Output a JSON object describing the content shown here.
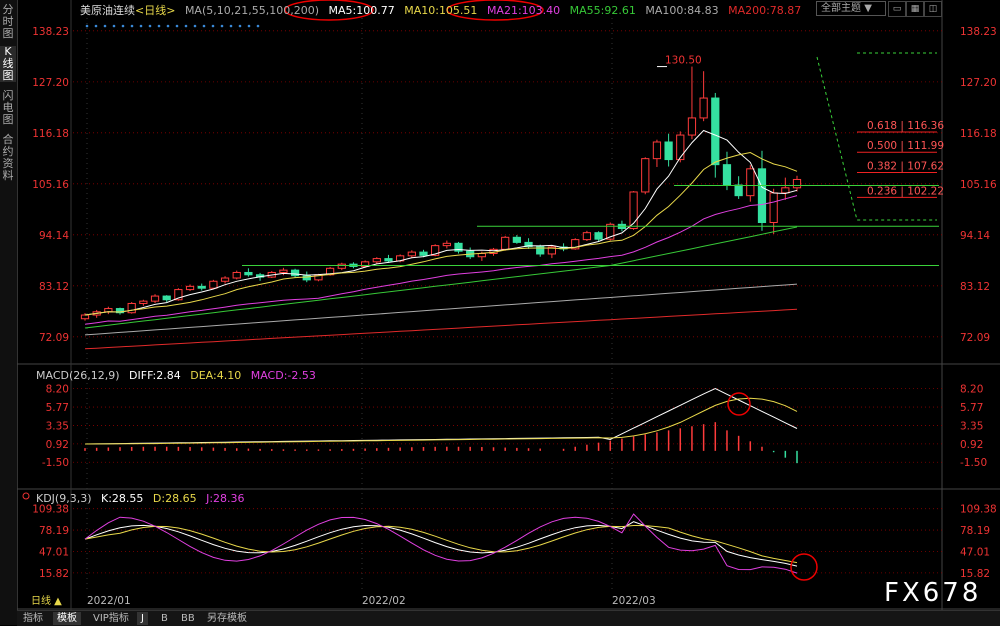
{
  "sidebar": {
    "tabs": [
      "分时图",
      "K线图",
      "闪电图",
      "合约资料"
    ]
  },
  "header": {
    "title": "美原油连续",
    "period": "<日线>",
    "ma_label": "MA(5,10,21,55,100,200)",
    "ma5": "MA5:100.77",
    "ma10": "MA10:105.51",
    "ma21": "MA21:103.40",
    "ma55": "MA55:92.61",
    "ma100": "MA100:84.83",
    "ma200": "MA200:78.87",
    "theme": "全部主题",
    "theme_arrow": "▼"
  },
  "colors": {
    "up": "#ff3b3b",
    "down": "#35e0a0",
    "ma5": "#ffffff",
    "ma10": "#e8d84a",
    "ma21": "#e040e0",
    "ma55": "#37c837",
    "ma100": "#aaaaaa",
    "ma200": "#e02a2a",
    "grid": "#8b0000",
    "level": "#3ad23a"
  },
  "chart_data": [
    {
      "type": "candlestick",
      "title": "美原油连续",
      "y_ticks": [
        "138.23",
        "127.20",
        "116.18",
        "105.16",
        "94.14",
        "83.12",
        "72.09"
      ],
      "ylim": [
        66,
        141
      ],
      "x_ticks": [
        "2022/01",
        "2022/02",
        "2022/03"
      ],
      "peak_label": "130.50",
      "fib_levels": [
        "0.618 | 116.36",
        "0.500 | 111.99",
        "0.382 | 107.62",
        "0.236 | 102.22"
      ],
      "candles": [
        [
          76.0,
          77.2,
          75.6,
          76.8
        ],
        [
          76.8,
          77.9,
          76.2,
          77.5
        ],
        [
          77.5,
          78.6,
          77.0,
          78.2
        ],
        [
          78.2,
          78.4,
          76.9,
          77.3
        ],
        [
          77.3,
          79.6,
          77.1,
          79.3
        ],
        [
          79.3,
          80.1,
          78.8,
          79.8
        ],
        [
          79.8,
          81.3,
          79.4,
          80.9
        ],
        [
          80.9,
          81.1,
          79.6,
          80.1
        ],
        [
          80.1,
          82.6,
          79.9,
          82.3
        ],
        [
          82.3,
          83.4,
          82.0,
          83.0
        ],
        [
          83.0,
          83.6,
          82.1,
          82.6
        ],
        [
          82.6,
          84.4,
          82.4,
          84.1
        ],
        [
          84.1,
          85.2,
          83.6,
          84.8
        ],
        [
          84.8,
          86.4,
          84.5,
          86.0
        ],
        [
          86.0,
          86.9,
          85.1,
          85.5
        ],
        [
          85.5,
          85.9,
          84.2,
          85.0
        ],
        [
          85.0,
          86.3,
          84.8,
          86.0
        ],
        [
          86.0,
          87.0,
          85.4,
          86.5
        ],
        [
          86.5,
          86.8,
          84.9,
          85.3
        ],
        [
          85.3,
          86.2,
          83.9,
          84.4
        ],
        [
          84.4,
          85.7,
          84.1,
          85.5
        ],
        [
          85.5,
          87.2,
          85.3,
          86.9
        ],
        [
          86.9,
          88.1,
          86.5,
          87.8
        ],
        [
          87.8,
          88.2,
          86.9,
          87.3
        ],
        [
          87.3,
          88.6,
          87.0,
          88.3
        ],
        [
          88.3,
          89.3,
          87.9,
          89.0
        ],
        [
          89.0,
          89.8,
          88.1,
          88.5
        ],
        [
          88.5,
          89.9,
          88.2,
          89.6
        ],
        [
          89.6,
          90.8,
          89.2,
          90.4
        ],
        [
          90.4,
          90.9,
          89.3,
          89.7
        ],
        [
          89.7,
          92.1,
          89.5,
          91.8
        ],
        [
          91.8,
          92.9,
          91.2,
          92.3
        ],
        [
          92.3,
          92.6,
          90.1,
          90.6
        ],
        [
          90.6,
          91.4,
          88.9,
          89.4
        ],
        [
          89.4,
          90.5,
          88.5,
          90.1
        ],
        [
          90.1,
          91.3,
          89.6,
          91.0
        ],
        [
          91.0,
          93.9,
          90.7,
          93.6
        ],
        [
          93.6,
          94.1,
          92.2,
          92.5
        ],
        [
          92.5,
          93.4,
          91.1,
          91.6
        ],
        [
          91.6,
          92.0,
          89.4,
          90.0
        ],
        [
          90.0,
          91.9,
          89.1,
          91.5
        ],
        [
          91.5,
          92.3,
          90.6,
          91.1
        ],
        [
          91.1,
          93.4,
          90.9,
          93.1
        ],
        [
          93.1,
          95.0,
          92.8,
          94.6
        ],
        [
          94.6,
          94.9,
          92.7,
          93.2
        ],
        [
          93.2,
          96.8,
          92.9,
          96.4
        ],
        [
          96.4,
          97.2,
          94.9,
          95.5
        ],
        [
          95.5,
          103.6,
          95.2,
          103.4
        ],
        [
          103.4,
          110.9,
          102.9,
          110.6
        ],
        [
          110.6,
          114.7,
          108.8,
          114.2
        ],
        [
          114.2,
          116.0,
          108.9,
          110.4
        ],
        [
          110.4,
          116.5,
          109.8,
          115.7
        ],
        [
          115.7,
          130.5,
          114.8,
          119.4
        ],
        [
          119.4,
          129.5,
          118.7,
          123.7
        ],
        [
          123.7,
          124.8,
          106.5,
          109.3
        ],
        [
          109.3,
          112.1,
          103.8,
          104.9
        ],
        [
          104.9,
          106.8,
          101.9,
          102.6
        ],
        [
          102.6,
          109.2,
          101.3,
          108.4
        ],
        [
          108.4,
          112.3,
          95.0,
          96.8
        ],
        [
          96.8,
          104.1,
          94.3,
          103.2
        ],
        [
          103.2,
          106.5,
          101.7,
          104.3
        ],
        [
          104.3,
          106.9,
          103.5,
          106.1
        ]
      ],
      "ma_values": {
        "ma5": "MA5:100.77",
        "ma10": "MA10:105.51",
        "ma21": "MA21:103.40",
        "ma55": "MA55:92.61",
        "ma100": "MA100:84.83",
        "ma200": "MA200:78.87"
      },
      "horizontal_levels": [
        104.8,
        96.0,
        87.5
      ]
    },
    {
      "type": "bar+line",
      "title": "MACD(26,12,9)",
      "diff": "DIFF:2.84",
      "dea": "DEA:4.10",
      "macd": "MACD:-2.53",
      "y_ticks": [
        "8.20",
        "5.77",
        "3.35",
        "0.92",
        "-1.50"
      ],
      "ylim": [
        -4.5,
        9.6
      ]
    },
    {
      "type": "line",
      "title": "KDJ(9,3,3)",
      "k": "K:28.55",
      "d": "D:28.65",
      "j": "J:28.36",
      "y_ticks": [
        "109.38",
        "78.19",
        "47.01",
        "15.82"
      ],
      "ylim": [
        -12,
        122
      ]
    }
  ],
  "bottom": {
    "period_btn": "日线 ▲",
    "tabs": [
      "指标",
      "模板",
      "VIP指标",
      "J",
      "B",
      "BB",
      "另存模板"
    ]
  },
  "watermark": "FX678"
}
